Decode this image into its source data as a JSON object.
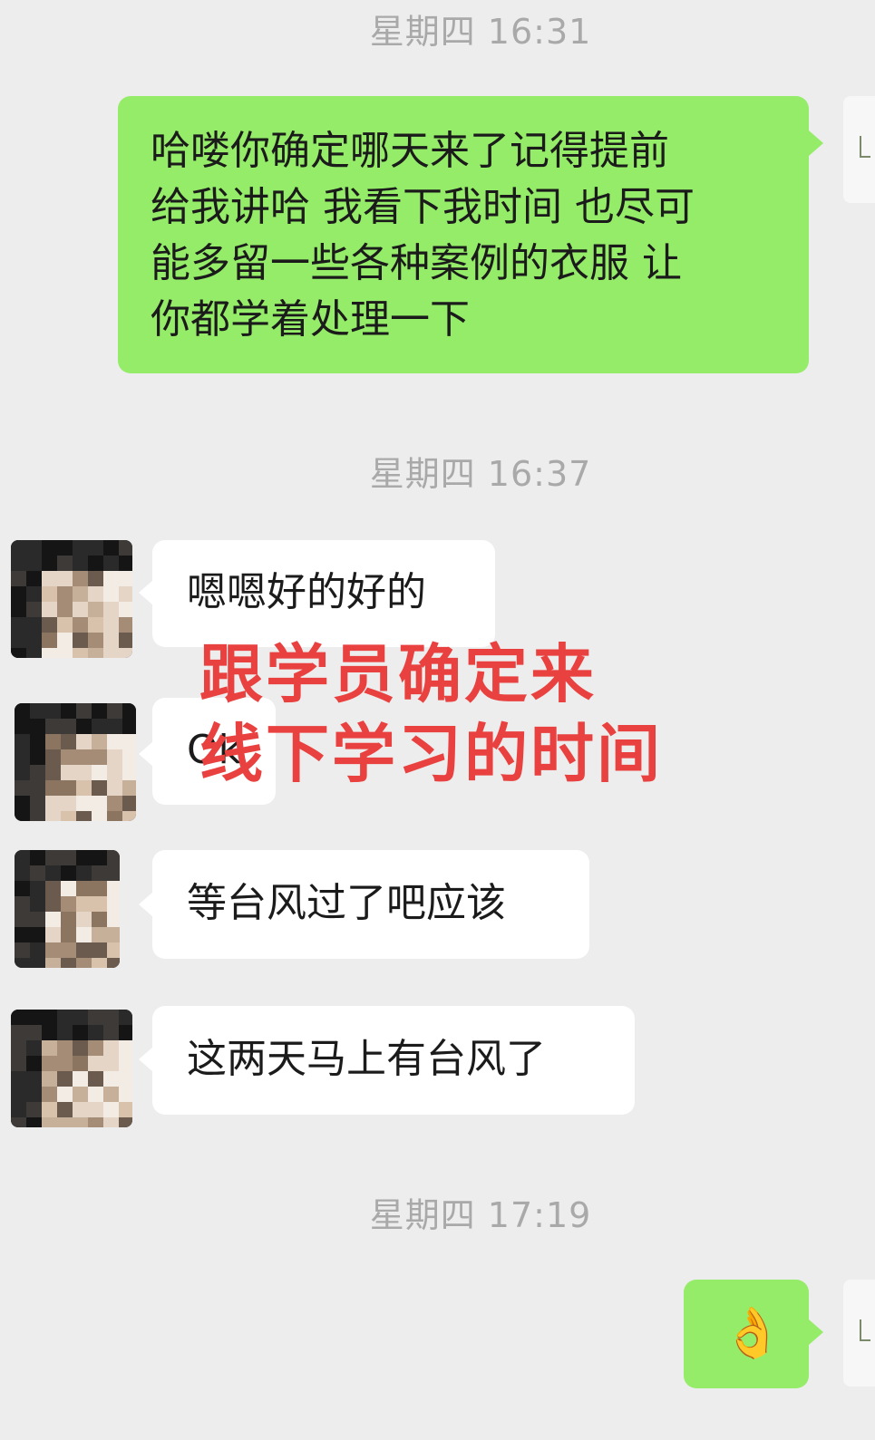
{
  "timestamps": [
    "星期四 16:31",
    "星期四 16:37",
    "星期四 17:19"
  ],
  "messages": {
    "m1_lines": [
      "哈喽你确定哪天来了记得提前",
      "给我讲哈 我看下我时间 也尽可",
      "能多留一些各种案例的衣服 让",
      "你都学着处理一下"
    ],
    "m2": "嗯嗯好的好的",
    "m3": "Ok",
    "m4": "等台风过了吧应该",
    "m5": "这两天马上有台风了",
    "m6": "👌"
  },
  "overlay": {
    "line1": "跟学员确定来",
    "line2": "线下学习的时间"
  },
  "colors": {
    "background": "#ededed",
    "sent_bubble": "#95ec69",
    "received_bubble": "#ffffff",
    "overlay_text": "#e8413f",
    "timestamp": "#a9a9a9"
  }
}
